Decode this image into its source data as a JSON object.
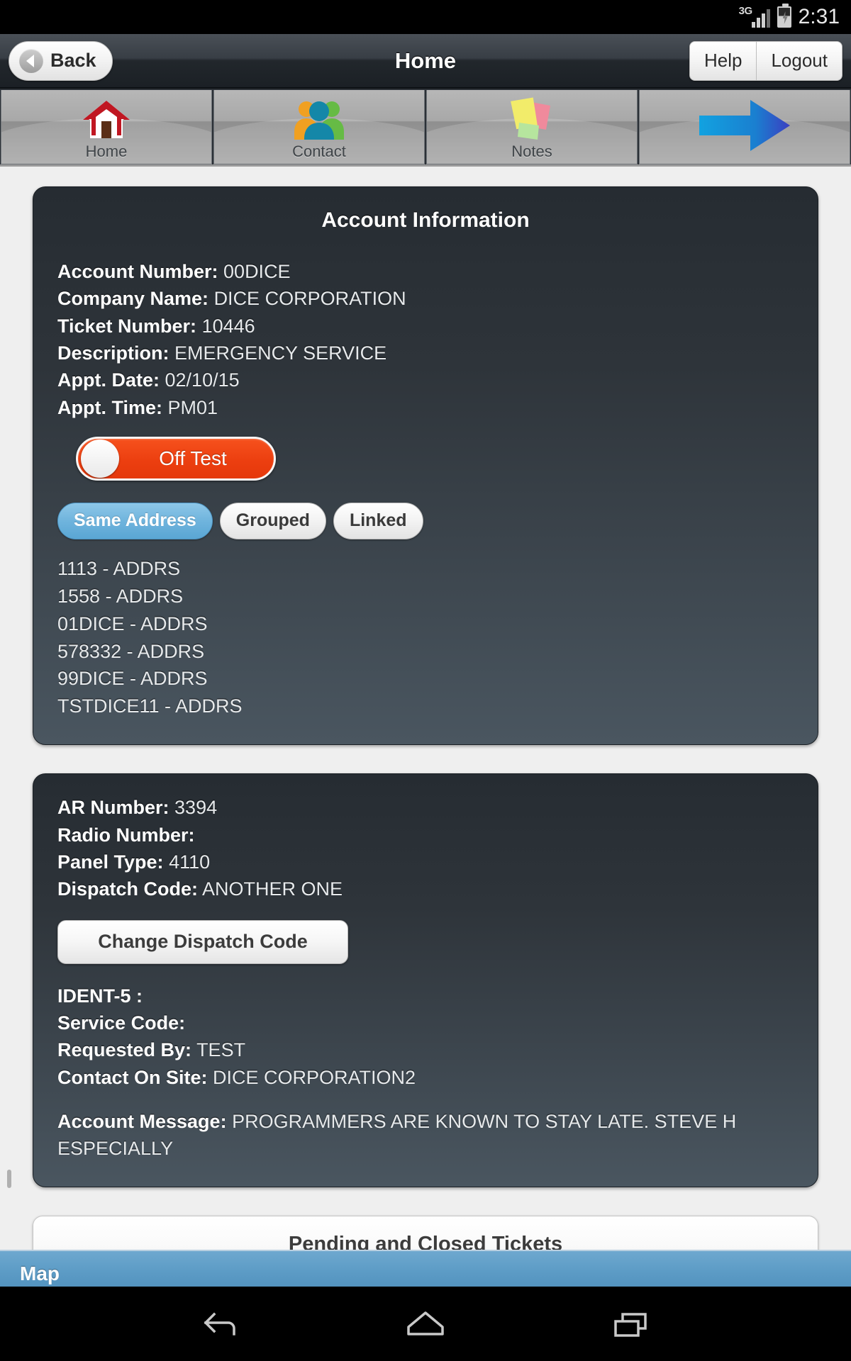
{
  "status_bar": {
    "network": "3G",
    "battery_icon": "battery-charging-icon",
    "time": "2:31"
  },
  "nav_bar": {
    "back_label": "Back",
    "title": "Home",
    "help_label": "Help",
    "logout_label": "Logout"
  },
  "tabs": [
    {
      "label": "Home",
      "icon": "house-icon"
    },
    {
      "label": "Contact",
      "icon": "people-icon"
    },
    {
      "label": "Notes",
      "icon": "sticky-notes-icon"
    },
    {
      "label": "",
      "icon": "blue-arrow-right-icon"
    }
  ],
  "account_card": {
    "title": "Account Information",
    "fields": [
      {
        "label": "Account Number:",
        "value": "00DICE"
      },
      {
        "label": "Company Name:",
        "value": "DICE CORPORATION"
      },
      {
        "label": "Ticket Number:",
        "value": "10446"
      },
      {
        "label": "Description:",
        "value": "EMERGENCY SERVICE"
      },
      {
        "label": "Appt. Date:",
        "value": "02/10/15"
      },
      {
        "label": "Appt. Time:",
        "value": "PM01"
      }
    ],
    "toggle": {
      "label": "Off Test",
      "state": "off",
      "color": "#ec3f10"
    },
    "segmented": {
      "options": [
        "Same Address",
        "Grouped",
        "Linked"
      ],
      "selected": "Same Address",
      "selected_color": "#6fb4dd"
    },
    "addresses": [
      "1113 - ADDRS",
      "1558 - ADDRS",
      "01DICE - ADDRS",
      "578332 - ADDRS",
      "99DICE - ADDRS",
      "TSTDICE11 - ADDRS"
    ]
  },
  "details_card": {
    "fields_top": [
      {
        "label": "AR Number:",
        "value": "3394"
      },
      {
        "label": "Radio Number:",
        "value": ""
      },
      {
        "label": "Panel Type:",
        "value": "4110"
      },
      {
        "label": "Dispatch Code:",
        "value": "ANOTHER ONE"
      }
    ],
    "change_dispatch_button": "Change Dispatch Code",
    "fields_bottom": [
      {
        "label": "IDENT-5 :",
        "value": ""
      },
      {
        "label": "Service Code:",
        "value": ""
      },
      {
        "label": "Requested By:",
        "value": "TEST"
      },
      {
        "label": "Contact On Site:",
        "value": "DICE CORPORATION2"
      }
    ],
    "account_message": {
      "label": "Account Message:",
      "value": "PROGRAMMERS ARE KNOWN TO STAY LATE. STEVE H ESPECIALLY"
    }
  },
  "pending_tickets_button": "Pending and Closed Tickets",
  "map_section": {
    "title": "Map",
    "color": "#5d9cc6"
  },
  "android_nav": {
    "back": "back-icon",
    "home": "home-icon",
    "recents": "recents-icon"
  }
}
